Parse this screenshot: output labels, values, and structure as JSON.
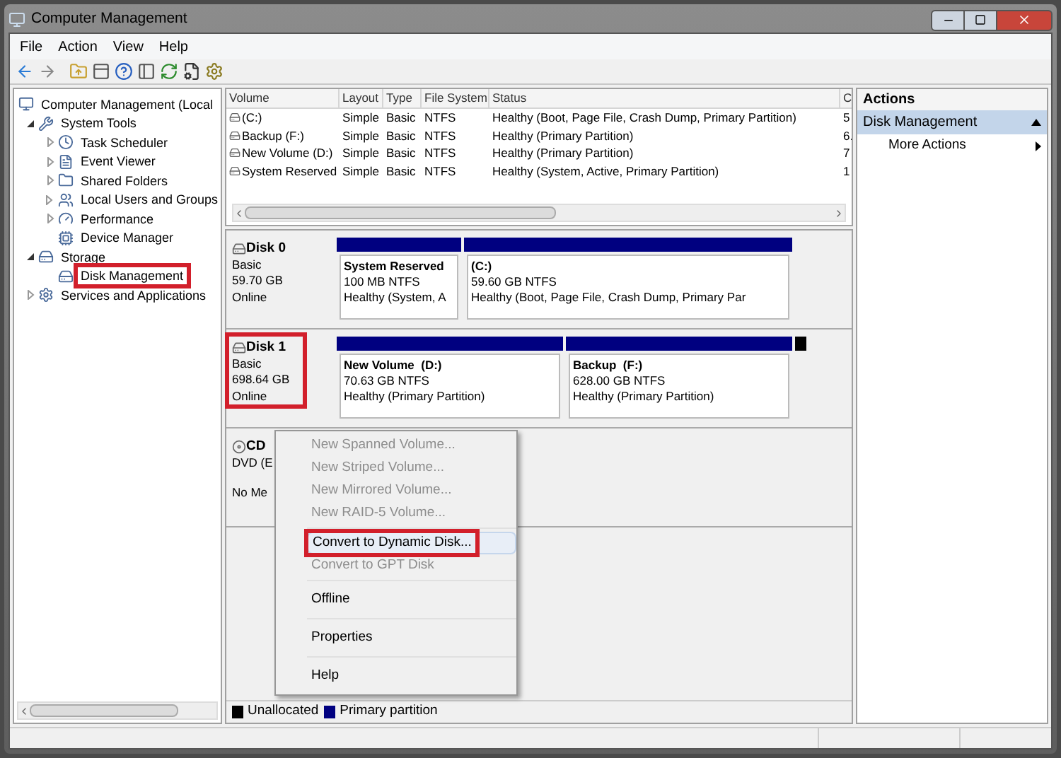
{
  "window": {
    "title": "Computer Management"
  },
  "menu_bar": [
    "File",
    "Action",
    "View",
    "Help"
  ],
  "tree": [
    {
      "label": "Computer Management (Local",
      "children": [
        {
          "label": "System Tools",
          "expanded": true,
          "children": [
            {
              "label": "Task Scheduler",
              "expanded": false
            },
            {
              "label": "Event Viewer",
              "expanded": false
            },
            {
              "label": "Shared Folders",
              "expanded": false
            },
            {
              "label": "Local Users and Groups",
              "expanded": false
            },
            {
              "label": "Performance",
              "expanded": false
            },
            {
              "label": "Device Manager"
            }
          ]
        },
        {
          "label": "Storage",
          "expanded": true,
          "children": [
            {
              "label": "Disk Management",
              "highlighted": true
            }
          ]
        },
        {
          "label": "Services and Applications",
          "expanded": false
        }
      ]
    }
  ],
  "volume_table": {
    "columns": [
      "Volume",
      "Layout",
      "Type",
      "File System",
      "Status",
      "C"
    ],
    "rows": [
      [
        "(C:)",
        "Simple",
        "Basic",
        "NTFS",
        "Healthy (Boot, Page File, Crash Dump, Primary Partition)",
        "5"
      ],
      [
        "Backup (F:)",
        "Simple",
        "Basic",
        "NTFS",
        "Healthy (Primary Partition)",
        "6."
      ],
      [
        "New Volume (D:)",
        "Simple",
        "Basic",
        "NTFS",
        "Healthy (Primary Partition)",
        "7"
      ],
      [
        "System Reserved",
        "Simple",
        "Basic",
        "NTFS",
        "Healthy (System, Active, Primary Partition)",
        "1"
      ]
    ]
  },
  "disks": [
    {
      "kind": "disk",
      "name": "Disk 0",
      "type": "Basic",
      "size": "59.70 GB",
      "state": "Online",
      "highlighted": false,
      "partitions": [
        {
          "name": "System Reserved",
          "size": "100 MB NTFS",
          "status": "Healthy (System, A",
          "color": "#000080"
        },
        {
          "name": "(C:)",
          "size": "59.60 GB NTFS",
          "status": "Healthy (Boot, Page File, Crash Dump, Primary Par",
          "color": "#000080"
        }
      ]
    },
    {
      "kind": "disk",
      "name": "Disk 1",
      "type": "Basic",
      "size": "698.64 GB",
      "state": "Online",
      "highlighted": true,
      "partitions": [
        {
          "name": "New Volume  (D:)",
          "size": "70.63 GB NTFS",
          "status": "Healthy (Primary Partition)",
          "color": "#000080"
        },
        {
          "name": "Backup  (F:)",
          "size": "628.00 GB NTFS",
          "status": "Healthy (Primary Partition)",
          "color": "#000080"
        },
        {
          "color": "#000000"
        }
      ]
    },
    {
      "kind": "cdrom",
      "name": "CD",
      "type": "DVD (E",
      "state": "No Me"
    }
  ],
  "legend": [
    {
      "label": "Unallocated",
      "color": "#000000"
    },
    {
      "label": "Primary partition",
      "color": "#000080"
    }
  ],
  "context_menu": [
    [
      {
        "label": "New Spanned Volume...",
        "disabled": true,
        "highlighted": false
      },
      {
        "label": "New Striped Volume...",
        "disabled": true,
        "highlighted": false
      },
      {
        "label": "New Mirrored Volume...",
        "disabled": true,
        "highlighted": false
      },
      {
        "label": "New RAID-5 Volume...",
        "disabled": true,
        "highlighted": false
      }
    ],
    [
      {
        "label": "Convert to Dynamic Disk...",
        "disabled": false,
        "highlighted": true
      },
      {
        "label": "Convert to GPT Disk",
        "disabled": true,
        "highlighted": false
      }
    ],
    [
      {
        "label": "Offline",
        "disabled": false,
        "highlighted": false
      }
    ],
    [
      {
        "label": "Properties",
        "disabled": false,
        "highlighted": false
      }
    ],
    [
      {
        "label": "Help",
        "disabled": false,
        "highlighted": false
      }
    ]
  ],
  "actions": {
    "title": "Actions",
    "sections": [
      {
        "label": "Disk Management",
        "expanded": true,
        "items": [
          "More Actions"
        ]
      }
    ]
  }
}
